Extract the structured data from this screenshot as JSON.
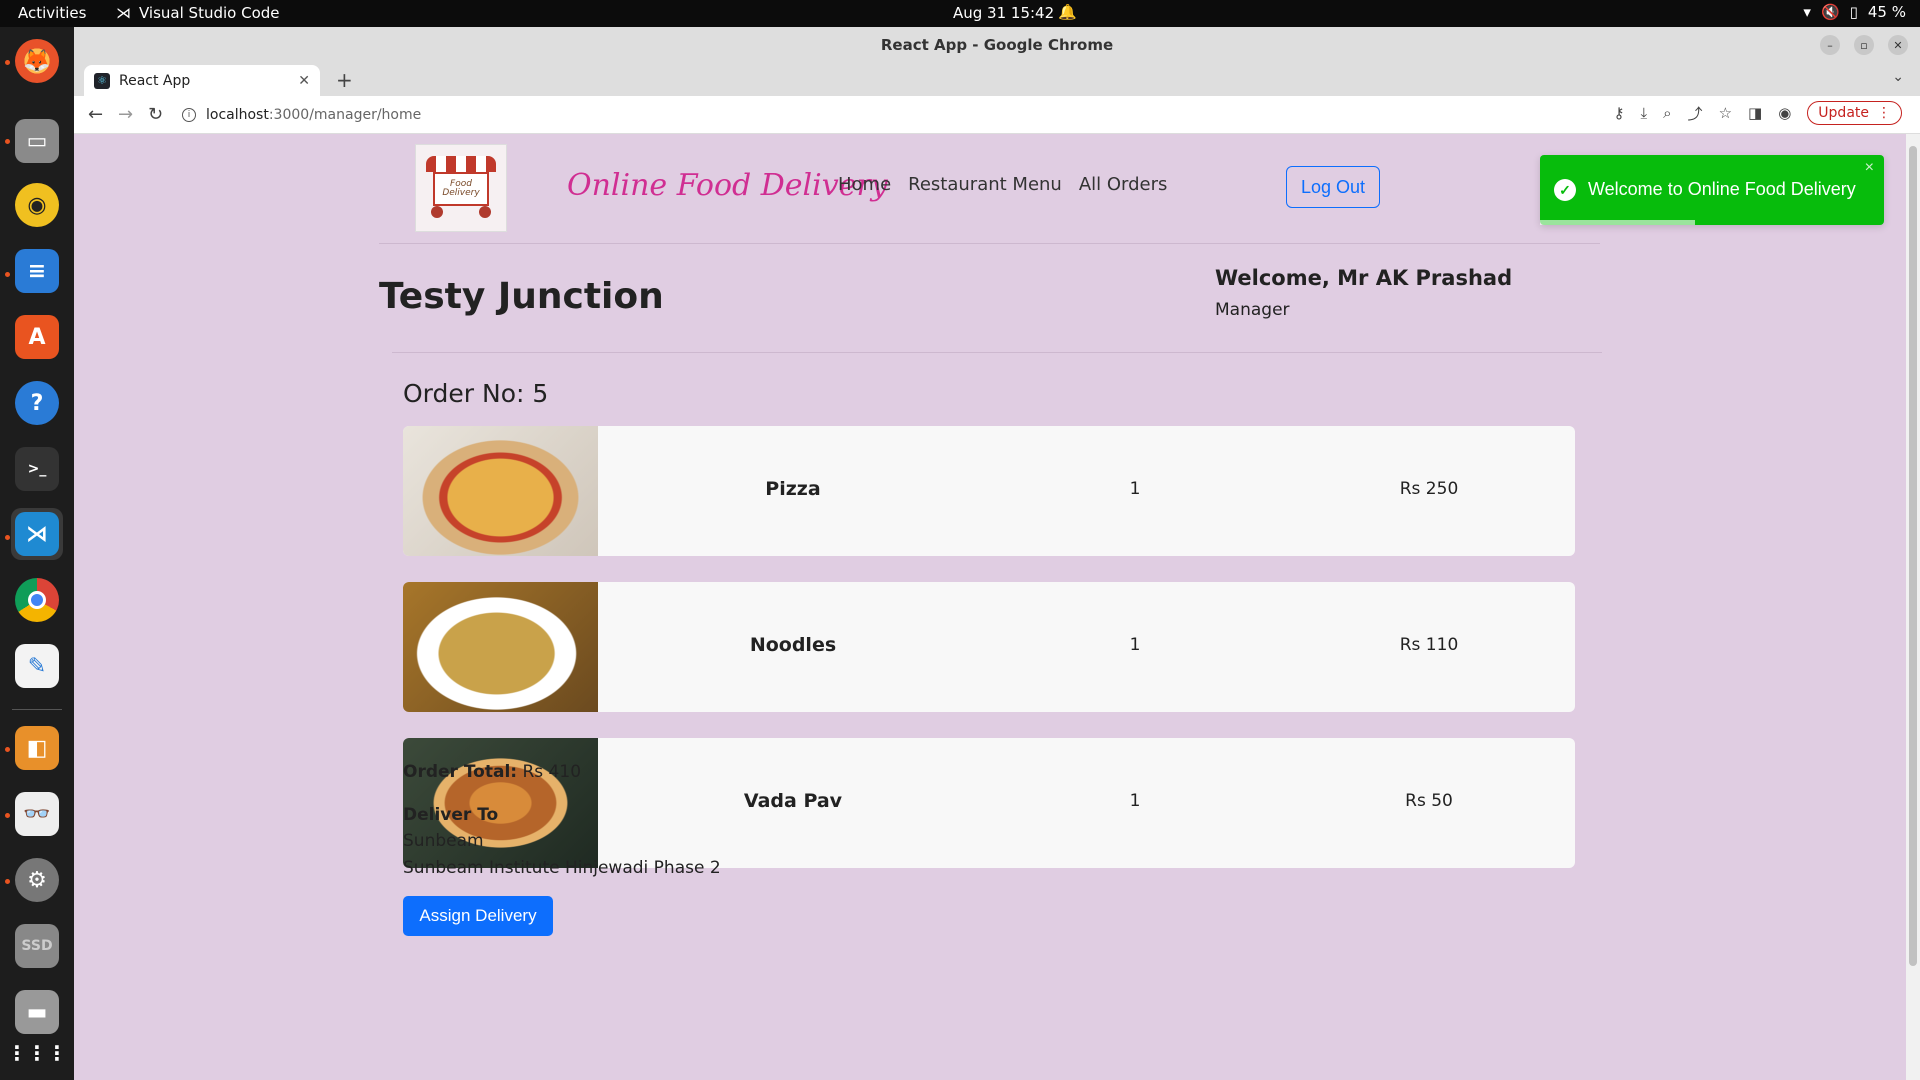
{
  "os": {
    "activities": "Activities",
    "active_app": "Visual Studio Code",
    "datetime": "Aug 31  15:42",
    "battery": "45 %"
  },
  "dock": {
    "items": [
      "firefox",
      "files",
      "rhythmbox",
      "writer",
      "app-center",
      "help",
      "terminal",
      "vscode",
      "chrome",
      "text-editor",
      "impress",
      "document-viewer",
      "settings",
      "ssd",
      "trash",
      "app-grid"
    ]
  },
  "browser": {
    "window_title": "React App - Google Chrome",
    "tab_title": "React App",
    "url_host": "localhost",
    "url_path": ":3000/manager/home",
    "update_label": "Update"
  },
  "header": {
    "brand": "Online Food Delivery",
    "logo_text": "Food Delivery",
    "nav": [
      "Home",
      "Restaurant Menu",
      "All Orders"
    ],
    "logout_label": "Log Out"
  },
  "toast": {
    "message": "Welcome to Online Food Delivery",
    "close": "×"
  },
  "restaurant": {
    "name": "Testy Junction",
    "welcome": "Welcome, Mr AK Prashad",
    "role": "Manager"
  },
  "order": {
    "title": "Order No: 5",
    "items": [
      {
        "name": "Pizza",
        "qty": "1",
        "price": "Rs 250",
        "image": "pizza"
      },
      {
        "name": "Noodles",
        "qty": "1",
        "price": "Rs 110",
        "image": "noodles"
      },
      {
        "name": "Vada Pav",
        "qty": "1",
        "price": "Rs 50",
        "image": "vada-pav"
      }
    ],
    "total_label": "Order Total:",
    "total_value": "Rs 410",
    "deliver_to_label": "Deliver To",
    "deliver_name": "Sunbeam",
    "deliver_address": "Sunbeam Institute Hinjewadi Phase 2",
    "assign_label": "Assign Delivery"
  },
  "colors": {
    "page_bg": "#e0cde2",
    "brand": "#d02e92",
    "primary": "#0d6efd",
    "toast": "#07bc0c"
  }
}
